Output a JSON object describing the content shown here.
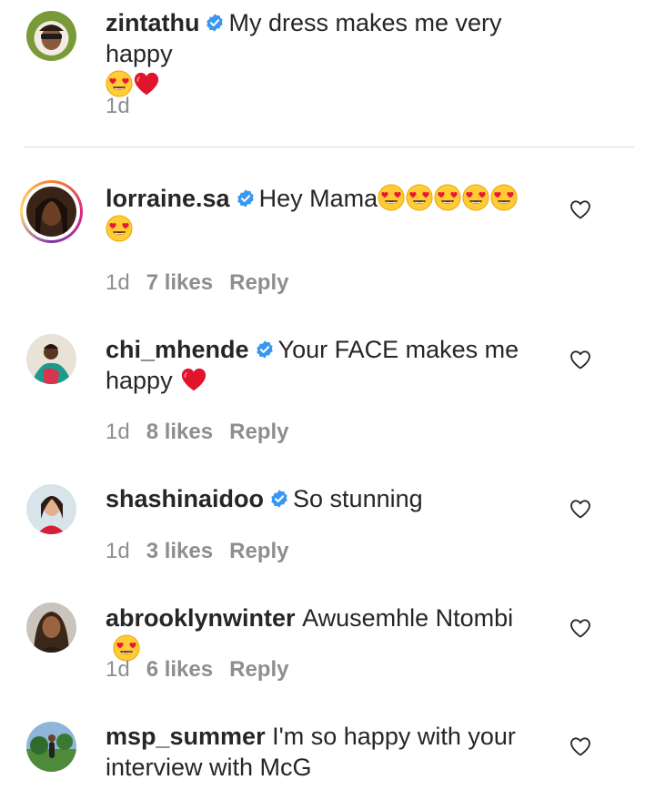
{
  "comments": [
    {
      "username": "zintathu",
      "text": "My dress makes me very happy",
      "emojis": [
        "heart-eyes",
        "red-heart"
      ],
      "time": "1d",
      "likes": "",
      "reply": "",
      "verified": true
    },
    {
      "username": "lorraine.sa",
      "text": "Hey Mama",
      "emojis": [
        "heart-eyes",
        "heart-eyes",
        "heart-eyes",
        "heart-eyes",
        "heart-eyes",
        "heart-eyes"
      ],
      "time": "1d",
      "likes": "7 likes",
      "reply": "Reply",
      "verified": true
    },
    {
      "username": "chi_mhende",
      "text": "Your FACE makes me happy",
      "emojis": [
        "red-heart"
      ],
      "time": "1d",
      "likes": "8 likes",
      "reply": "Reply",
      "verified": true
    },
    {
      "username": "shashinaidoo",
      "text": "So stunning",
      "emojis": [],
      "time": "1d",
      "likes": "3 likes",
      "reply": "Reply",
      "verified": true
    },
    {
      "username": "abrooklynwinter",
      "text": "Awusemhle Ntombi",
      "emojis": [
        "heart-eyes"
      ],
      "time": "1d",
      "likes": "6 likes",
      "reply": "Reply",
      "verified": false
    },
    {
      "username": "msp_summer",
      "text": "I'm so happy with your interview with McG",
      "emojis": [],
      "time": "",
      "likes": "",
      "reply": "",
      "verified": false
    }
  ],
  "icons": {
    "verified": "verified-badge-icon",
    "like": "heart-outline-icon"
  },
  "colors": {
    "verified_blue": "#3897f0",
    "meta_gray": "#8e8e8e",
    "heart_red": "#e0152b"
  }
}
